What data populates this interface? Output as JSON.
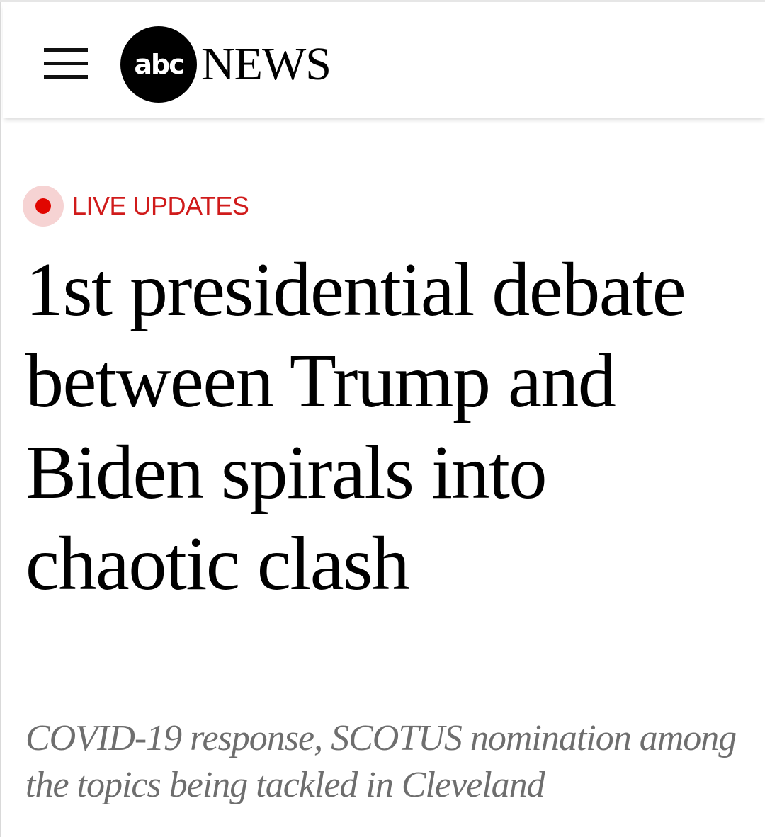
{
  "header": {
    "menu_icon": "hamburger-menu-icon",
    "logo": {
      "mark_text": "abc",
      "word_text": "NEWS"
    }
  },
  "article": {
    "live_badge": {
      "icon": "live-dot-icon",
      "label": "LIVE UPDATES",
      "color": "#d01b1b"
    },
    "headline": "1st presidential debate between Trump and Biden spirals into chaotic clash",
    "subheadline": "COVID-19 response, SCOTUS nomination among the topics being tackled in Cleveland"
  }
}
